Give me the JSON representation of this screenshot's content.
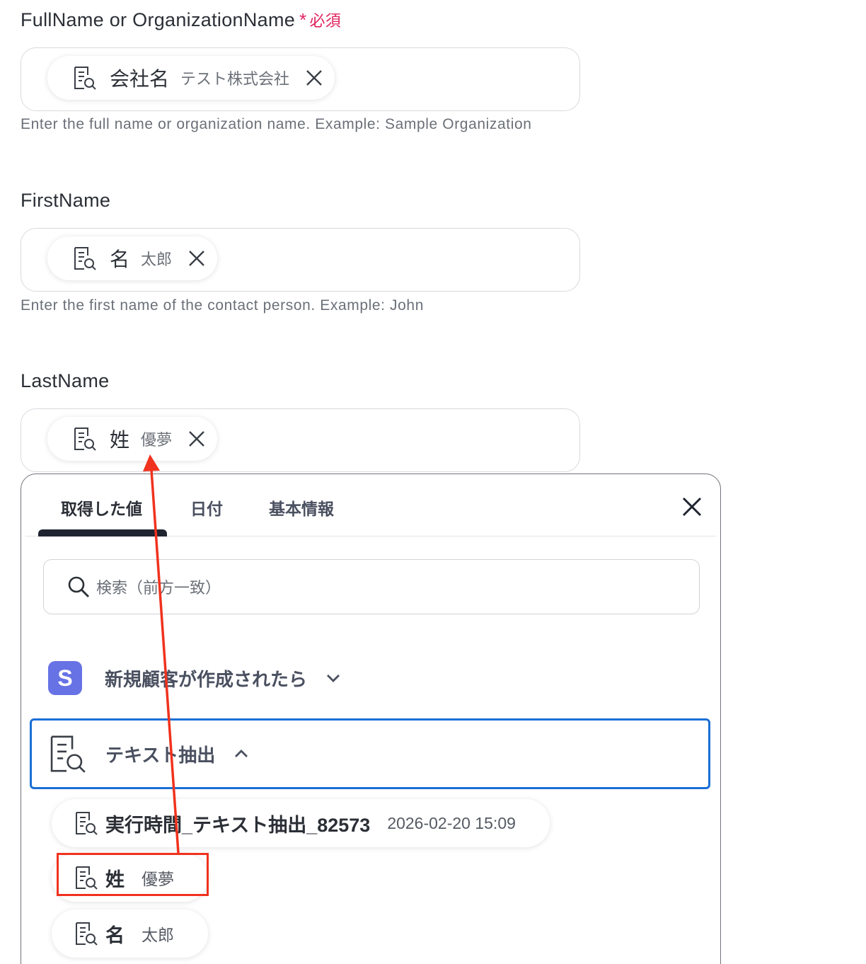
{
  "fields": [
    {
      "label": "FullName or OrganizationName",
      "required_mark": "*",
      "required_text": "必須",
      "chip_key": "会社名",
      "chip_value": "テスト株式会社",
      "helper": "Enter the full name or organization name. Example: Sample Organization"
    },
    {
      "label": "FirstName",
      "chip_key": "名",
      "chip_value": "太郎",
      "helper": "Enter the first name of the contact person. Example: John"
    },
    {
      "label": "LastName",
      "chip_key": "姓",
      "chip_value": "優夢"
    }
  ],
  "panel": {
    "tabs": [
      "取得した値",
      "日付",
      "基本情報"
    ],
    "active_tab": "取得した値",
    "search_placeholder": "検索（前方一致）",
    "sections": [
      {
        "logo_letter": "S",
        "title": "新規顧客が作成されたら",
        "expanded": false,
        "logo_color": "#6772e5"
      },
      {
        "title": "テキスト抽出",
        "expanded": true,
        "selected_border_color": "#1a6fd6"
      }
    ],
    "items": [
      {
        "key": "実行時間_テキスト抽出_82573",
        "value": "2026-02-20 15:09"
      },
      {
        "key": "姓",
        "value": "優夢",
        "highlighted": true
      },
      {
        "key": "名",
        "value": "太郎"
      }
    ]
  },
  "annotation": {
    "highlight_color": "#f0321e"
  },
  "colors": {
    "required": "#e0245e",
    "accent": "#1a6fd6",
    "text": "#2b2f36",
    "muted": "#6b7078"
  }
}
